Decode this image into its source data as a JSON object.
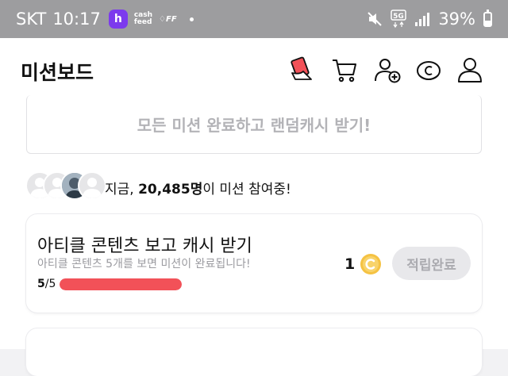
{
  "status_bar": {
    "carrier": "SKT",
    "time": "10:17",
    "app_notification_icons": [
      "h-app-icon",
      "cashfeed-icon",
      "ff-icon"
    ],
    "network": "5G",
    "battery": "39%",
    "battery_level": 0.39
  },
  "header": {
    "title": "미션보드",
    "icons": [
      "coupon-icon",
      "cart-icon",
      "add-friend-icon",
      "cash-icon",
      "profile-icon"
    ]
  },
  "banner": {
    "text": "모든 미션 완료하고 랜덤캐시 받기!"
  },
  "participants": {
    "prefix": "지금, ",
    "count": "20,485명",
    "suffix": "이 미션 참여중!"
  },
  "mission": {
    "title": "아티클 콘텐츠 보고 캐시 받기",
    "description": "아티클 콘텐츠 5개를 보면 미션이 완료됩니다!",
    "progress_done": "5",
    "progress_total": "/5",
    "progress_fraction": 1.0,
    "reward": "1",
    "status_button": "적립완료"
  },
  "colors": {
    "accent_red": "#f25158",
    "coin_gold": "#f5c242",
    "disabled_text": "#ababb0"
  }
}
